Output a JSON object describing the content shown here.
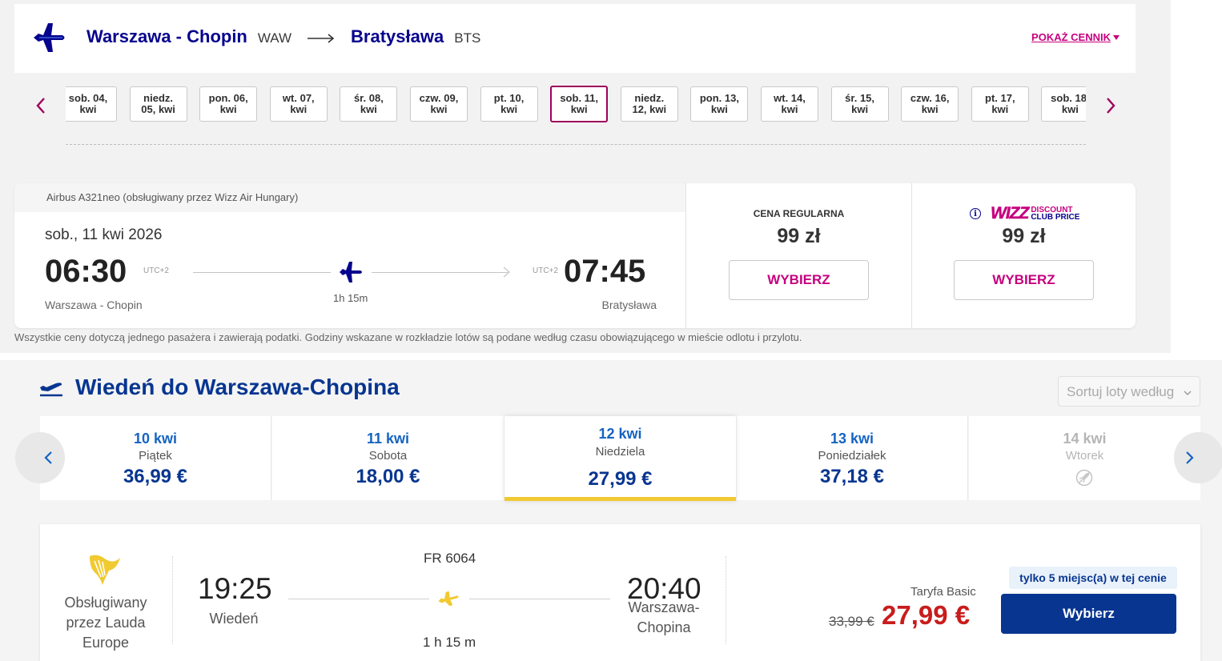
{
  "wizz": {
    "route": {
      "from_city": "Warszawa - Chopin",
      "from_code": "WAW",
      "to_city": "Bratysława",
      "to_code": "BTS"
    },
    "price_list_link": "POKAŻ CENNIK",
    "dates": [
      {
        "l1": "sob. 04,",
        "l2": "kwi"
      },
      {
        "l1": "niedz.",
        "l2": "05, kwi"
      },
      {
        "l1": "pon. 06,",
        "l2": "kwi"
      },
      {
        "l1": "wt. 07,",
        "l2": "kwi"
      },
      {
        "l1": "śr. 08,",
        "l2": "kwi"
      },
      {
        "l1": "czw. 09,",
        "l2": "kwi"
      },
      {
        "l1": "pt. 10,",
        "l2": "kwi"
      },
      {
        "l1": "sob. 11,",
        "l2": "kwi"
      },
      {
        "l1": "niedz.",
        "l2": "12, kwi"
      },
      {
        "l1": "pon. 13,",
        "l2": "kwi"
      },
      {
        "l1": "wt. 14,",
        "l2": "kwi"
      },
      {
        "l1": "śr. 15,",
        "l2": "kwi"
      },
      {
        "l1": "czw. 16,",
        "l2": "kwi"
      },
      {
        "l1": "pt. 17,",
        "l2": "kwi"
      },
      {
        "l1": "sob. 18,",
        "l2": "kwi"
      }
    ],
    "selected_date_index": 7,
    "flight": {
      "aircraft": "Airbus A321neo (obsługiwany przez Wizz Air Hungary)",
      "date": "sob., 11 kwi 2026",
      "dep_time": "06:30",
      "dep_utc": "UTC+2",
      "arr_utc": "UTC+2",
      "arr_time": "07:45",
      "duration": "1h 15m",
      "dep_city": "Warszawa - Chopin",
      "arr_city": "Bratysława"
    },
    "regular": {
      "title": "CENA REGULARNA",
      "price": "99 zł",
      "button": "WYBIERZ"
    },
    "club": {
      "logo_word": "WIZZ",
      "line1": "DISCOUNT",
      "line2": "CLUB PRICE",
      "info": "i",
      "price": "99 zł",
      "button": "WYBIERZ"
    },
    "footnote": "Wszystkie ceny dotyczą jednego pasażera i zawierają podatki. Godziny wskazane w rozkładzie lotów są podane według czasu obowiązującego w mieście odlotu i przylotu."
  },
  "ryanair": {
    "title": "Wiedeń do Warszawa-Chopina",
    "sort_label": "Sortuj loty według",
    "dates": [
      {
        "day": "10 kwi",
        "weekday": "Piątek",
        "price": "36,99 €"
      },
      {
        "day": "11 kwi",
        "weekday": "Sobota",
        "price": "18,00 €"
      },
      {
        "day": "12 kwi",
        "weekday": "Niedziela",
        "price": "27,99 €"
      },
      {
        "day": "13 kwi",
        "weekday": "Poniedziałek",
        "price": "37,18 €"
      },
      {
        "day": "14 kwi",
        "weekday": "Wtorek",
        "price": ""
      }
    ],
    "selected_date_index": 2,
    "flight": {
      "operator_l1": "Obsługiwany",
      "operator_l2": "przez Lauda",
      "operator_l3": "Europe",
      "flight_no": "FR 6064",
      "dep_time": "19:25",
      "dep_city": "Wiedeń",
      "arr_time": "20:40",
      "arr_city_l1": "Warszawa-",
      "arr_city_l2": "Chopina",
      "duration": "1 h 15 m"
    },
    "fare": {
      "name": "Taryfa Basic",
      "old_price": "33,99 €",
      "price": "27,99 €",
      "badge": "tylko 5 miejsc(a) w tej cenie",
      "button": "Wybierz"
    },
    "colors": {
      "brand_blue": "#073590",
      "accent_yellow": "#f1c931",
      "price_red": "#c91c1c"
    }
  },
  "icons": [
    "plane-icon",
    "arrow-right-icon",
    "chevron-left-icon",
    "chevron-right-icon",
    "info-icon",
    "ryanair-harp-logo",
    "no-flight-icon",
    "takeoff-icon",
    "chevron-down-icon"
  ]
}
